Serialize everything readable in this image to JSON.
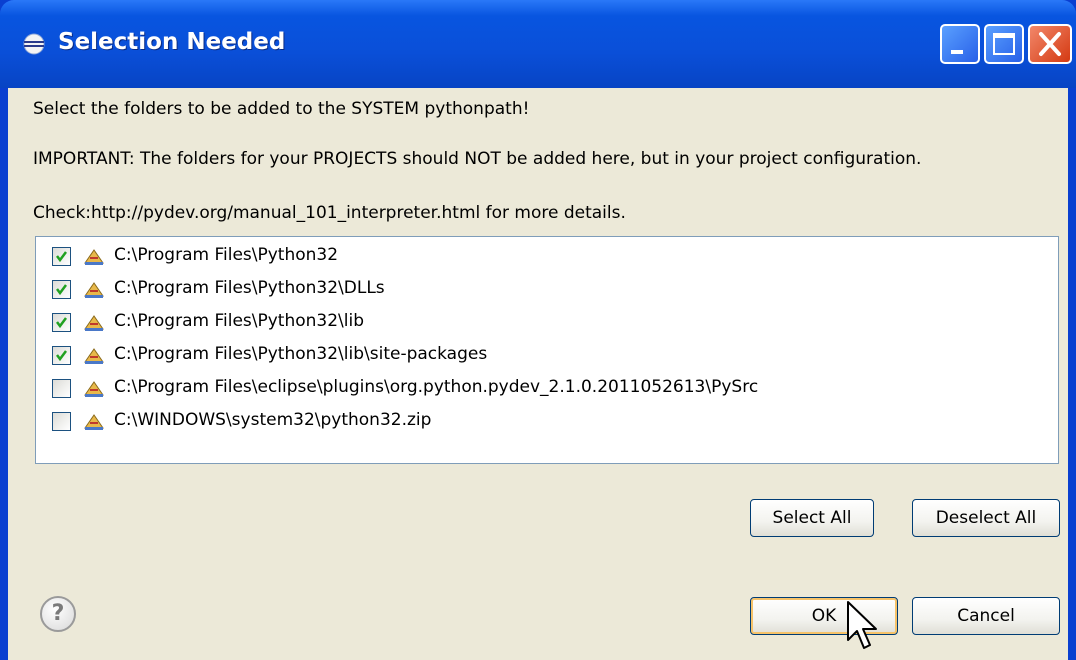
{
  "window": {
    "title": "Selection Needed",
    "controls": [
      "minimize-icon",
      "maximize-icon",
      "close-icon"
    ]
  },
  "messages": {
    "line1": "Select the folders to be added to the SYSTEM pythonpath!",
    "line2": "IMPORTANT: The folders for your PROJECTS should NOT be added here, but in your project configuration.",
    "line3": "Check:http://pydev.org/manual_101_interpreter.html for more details."
  },
  "folders": [
    {
      "path": "C:\\Program Files\\Python32",
      "checked": true
    },
    {
      "path": "C:\\Program Files\\Python32\\DLLs",
      "checked": true
    },
    {
      "path": "C:\\Program Files\\Python32\\lib",
      "checked": true
    },
    {
      "path": "C:\\Program Files\\Python32\\lib\\site-packages",
      "checked": true
    },
    {
      "path": "C:\\Program Files\\eclipse\\plugins\\org.python.pydev_2.1.0.2011052613\\PySrc",
      "checked": false
    },
    {
      "path": "C:\\WINDOWS\\system32\\python32.zip",
      "checked": false
    }
  ],
  "buttons": {
    "select_all": "Select All",
    "deselect_all": "Deselect All",
    "ok": "OK",
    "cancel": "Cancel",
    "help": "?"
  },
  "colors": {
    "title_bar": "#0a4fd8",
    "dialog_bg": "#ece9d8",
    "close_button": "#d43a12",
    "check_mark": "#21a121"
  }
}
